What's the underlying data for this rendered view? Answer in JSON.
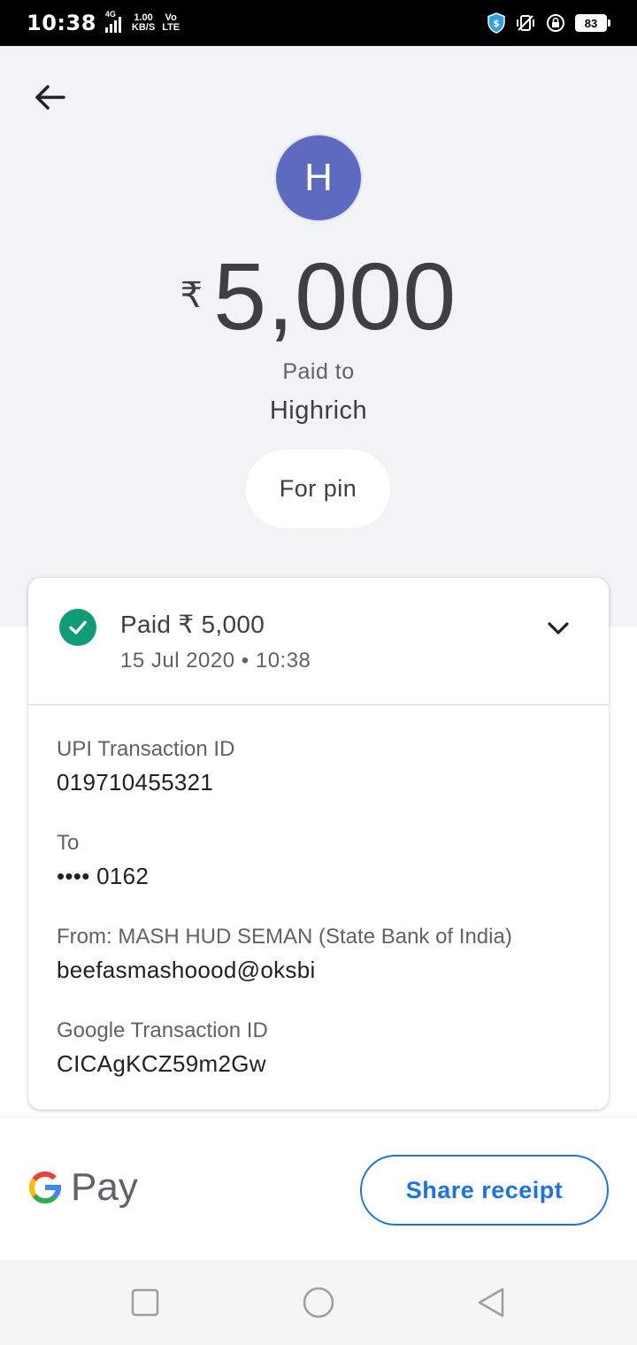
{
  "status_bar": {
    "time": "10:38",
    "network_type": "4G",
    "net_speed_value": "1.00",
    "net_speed_unit": "KB/S",
    "volte_top": "Vo",
    "volte_bottom": "LTE",
    "battery": "83",
    "icons": [
      "signal-icon",
      "shield-icon",
      "vibrate-icon",
      "alarm-lock-icon",
      "battery-icon"
    ]
  },
  "payment": {
    "avatar_letter": "H",
    "currency_symbol": "₹",
    "amount": "5,000",
    "paid_to_label": "Paid to",
    "payee": "Highrich",
    "note": "For pin"
  },
  "card": {
    "status_title": "Paid ₹ 5,000",
    "status_datetime": "15 Jul 2020 • 10:38",
    "details": [
      {
        "label": "UPI Transaction ID",
        "value": "019710455321"
      },
      {
        "label": "To",
        "value": "•••• 0162"
      },
      {
        "label": "From: MASH HUD  SEMAN (State Bank of India)",
        "value": "beefasmashoood@oksbi"
      },
      {
        "label": "Google Transaction ID",
        "value": "CICAgKCZ59m2Gw"
      }
    ]
  },
  "footer": {
    "brand_text": "Pay",
    "share_label": "Share receipt"
  },
  "colors": {
    "hero_bg": "#f1f3f4",
    "avatar": "#5c6bc0",
    "success": "#0f9d76",
    "accent": "#1a73e8"
  }
}
